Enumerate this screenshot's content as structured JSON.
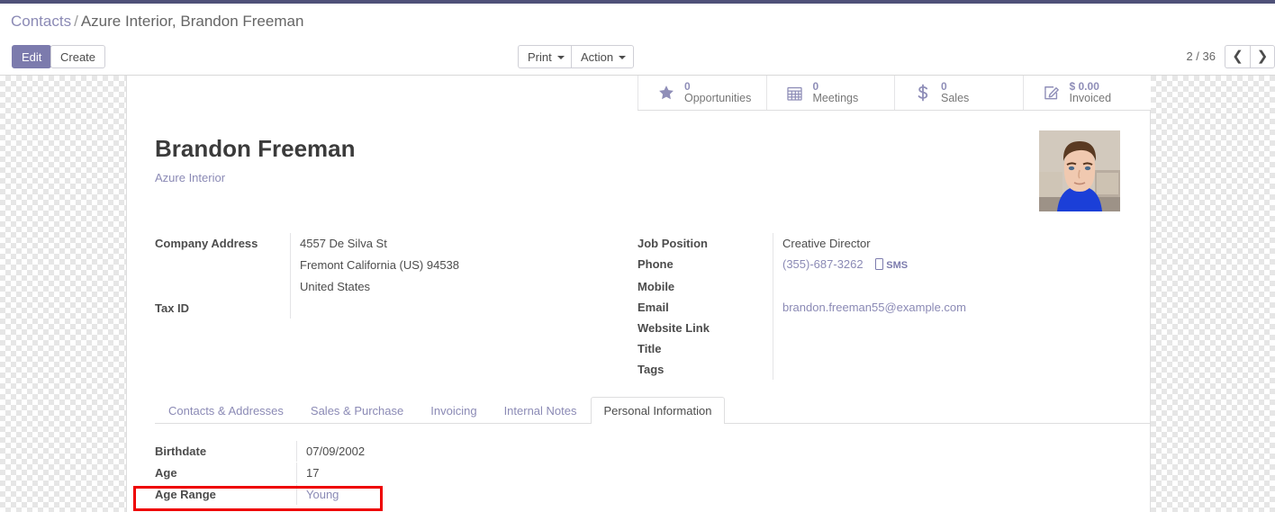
{
  "breadcrumb": {
    "root": "Contacts",
    "separator": "/",
    "current": "Azure Interior, Brandon Freeman"
  },
  "control_panel": {
    "edit_label": "Edit",
    "create_label": "Create",
    "print_label": "Print",
    "action_label": "Action",
    "pager_counter": "2 / 36",
    "pager_prev_icon": "chevron-left-icon",
    "pager_next_icon": "chevron-right-icon"
  },
  "stat_buttons": [
    {
      "icon": "star-icon",
      "value": "0",
      "label": "Opportunities"
    },
    {
      "icon": "calendar-icon",
      "value": "0",
      "label": "Meetings"
    },
    {
      "icon": "dollar-icon",
      "value": "0",
      "label": "Sales"
    },
    {
      "icon": "pencil-square-icon",
      "value": "$ 0.00",
      "label": "Invoiced"
    }
  ],
  "record": {
    "name": "Brandon Freeman",
    "company": "Azure Interior",
    "avatar_alt": "contact-photo"
  },
  "left_fields": {
    "company_address_label": "Company Address",
    "address_line1": "4557 De Silva St",
    "address_line2": "Fremont  California (US)  94538",
    "address_line3": "United States",
    "tax_id_label": "Tax ID",
    "tax_id_value": ""
  },
  "right_fields": {
    "job_position_label": "Job Position",
    "job_position_value": "Creative Director",
    "phone_label": "Phone",
    "phone_value": "(355)-687-3262",
    "sms_label": "SMS",
    "mobile_label": "Mobile",
    "mobile_value": "",
    "email_label": "Email",
    "email_value": "brandon.freeman55@example.com",
    "website_label": "Website Link",
    "website_value": "",
    "title_label": "Title",
    "title_value": "",
    "tags_label": "Tags",
    "tags_value": ""
  },
  "tabs": [
    {
      "label": "Contacts & Addresses",
      "active": false
    },
    {
      "label": "Sales & Purchase",
      "active": false
    },
    {
      "label": "Invoicing",
      "active": false
    },
    {
      "label": "Internal Notes",
      "active": false
    },
    {
      "label": "Personal Information",
      "active": true
    }
  ],
  "personal_information": {
    "birthdate_label": "Birthdate",
    "birthdate_value": "07/09/2002",
    "age_label": "Age",
    "age_value": "17",
    "age_range_label": "Age Range",
    "age_range_value": "Young"
  },
  "colors": {
    "brand_purple": "#7c7bad",
    "link_purple": "#8b8ab5",
    "top_bar": "#4f5178",
    "highlight_red": "#ee0000"
  }
}
